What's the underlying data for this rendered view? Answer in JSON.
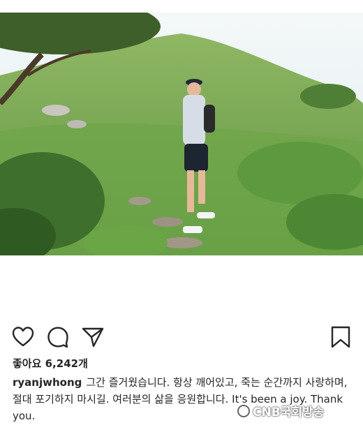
{
  "post": {
    "likes_text": "좋아요 6,242개",
    "username": "ryanjwhong",
    "caption_text": "그간 즐거웠습니다. 항상 깨어있고, 죽는 순간까지 사랑하며, 절대 포기하지 마시길. 여러분의 삶을 응원합니다. It's been a joy. Thank you."
  },
  "icons": {
    "like": "heart-icon",
    "comment": "speech-bubble-icon",
    "share": "paper-plane-icon",
    "save": "bookmark-icon"
  },
  "watermark": {
    "text": "CNB국회방송"
  },
  "colors": {
    "text": "#262626",
    "grass": "#7fb05a",
    "sky": "#eef6f8"
  }
}
